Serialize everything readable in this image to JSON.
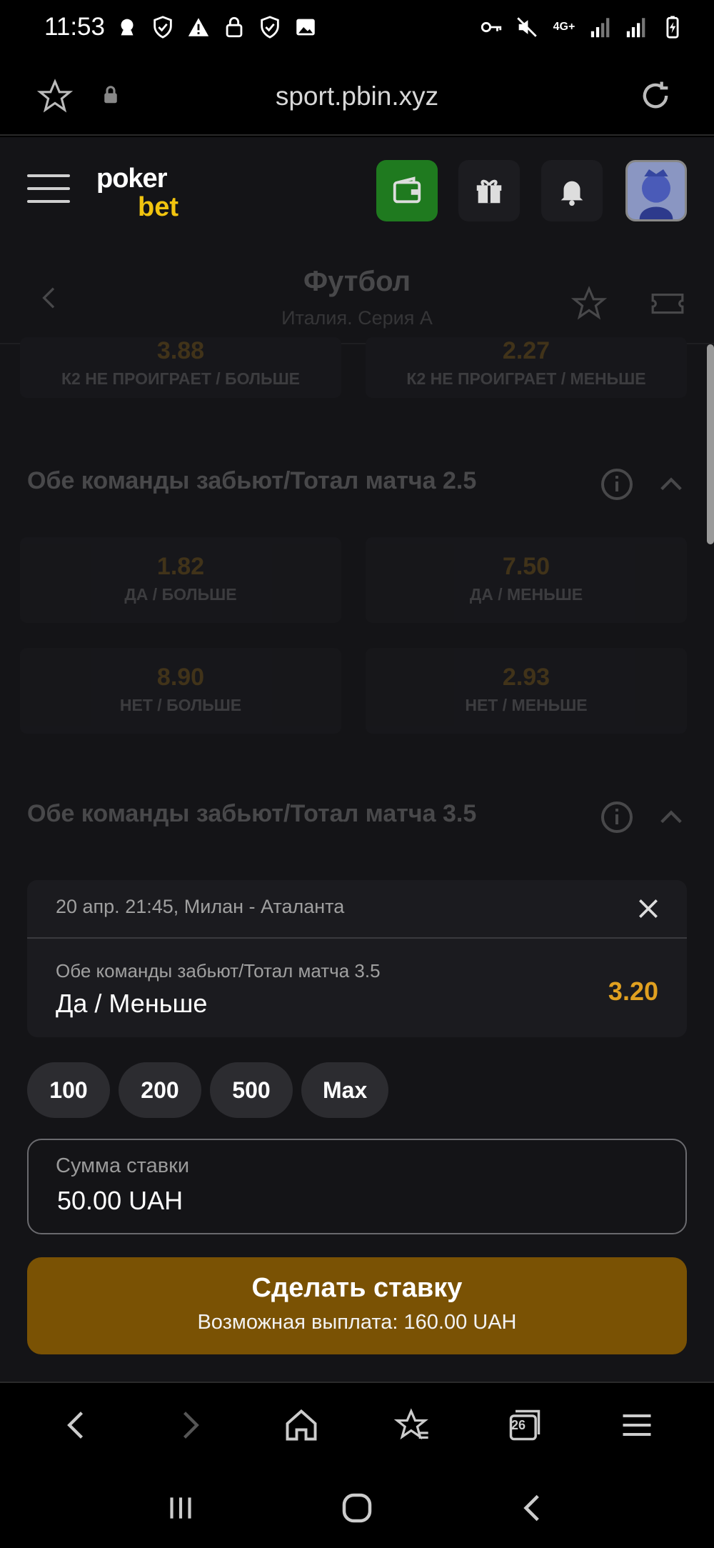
{
  "status_bar": {
    "time": "11:53",
    "network": "4G+"
  },
  "browser": {
    "url": "sport.pbin.xyz"
  },
  "site": {
    "logo_top": "poker",
    "logo_bottom": "bet"
  },
  "sport_header": {
    "title": "Футбол",
    "subtitle": "Италия. Серия А"
  },
  "markets": {
    "prev_row": [
      {
        "odds": "3.88",
        "label": "К2 НЕ ПРОИГРАЕТ / БОЛЬШЕ"
      },
      {
        "odds": "2.27",
        "label": "К2 НЕ ПРОИГРАЕТ / МЕНЬШЕ"
      }
    ],
    "market_25": {
      "title": "Обе команды забьют/Тотал матча 2.5",
      "options": [
        {
          "odds": "1.82",
          "label": "ДА / БОЛЬШЕ"
        },
        {
          "odds": "7.50",
          "label": "ДА / МЕНЬШЕ"
        },
        {
          "odds": "8.90",
          "label": "НЕТ / БОЛЬШЕ"
        },
        {
          "odds": "2.93",
          "label": "НЕТ / МЕНЬШЕ"
        }
      ]
    },
    "market_35": {
      "title": "Обе команды забьют/Тотал матча 3.5"
    }
  },
  "bet_slip": {
    "match": "20 апр. 21:45, Милан - Аталанта",
    "market": "Обе команды забьют/Тотал матча 3.5",
    "pick": "Да / Меньше",
    "odds": "3.20",
    "quick_amounts": [
      "100",
      "200",
      "500",
      "Max"
    ],
    "stake_label": "Сумма ставки",
    "stake_value": "50.00 UAH",
    "submit_title": "Сделать ставку",
    "submit_sub": "Возможная выплата: 160.00 UAH"
  },
  "toolbar": {
    "tabs_count": "26"
  },
  "colors": {
    "accent": "#e0a020",
    "submit_bg": "#7a5204",
    "wallet_bg": "#1f7a1f"
  }
}
